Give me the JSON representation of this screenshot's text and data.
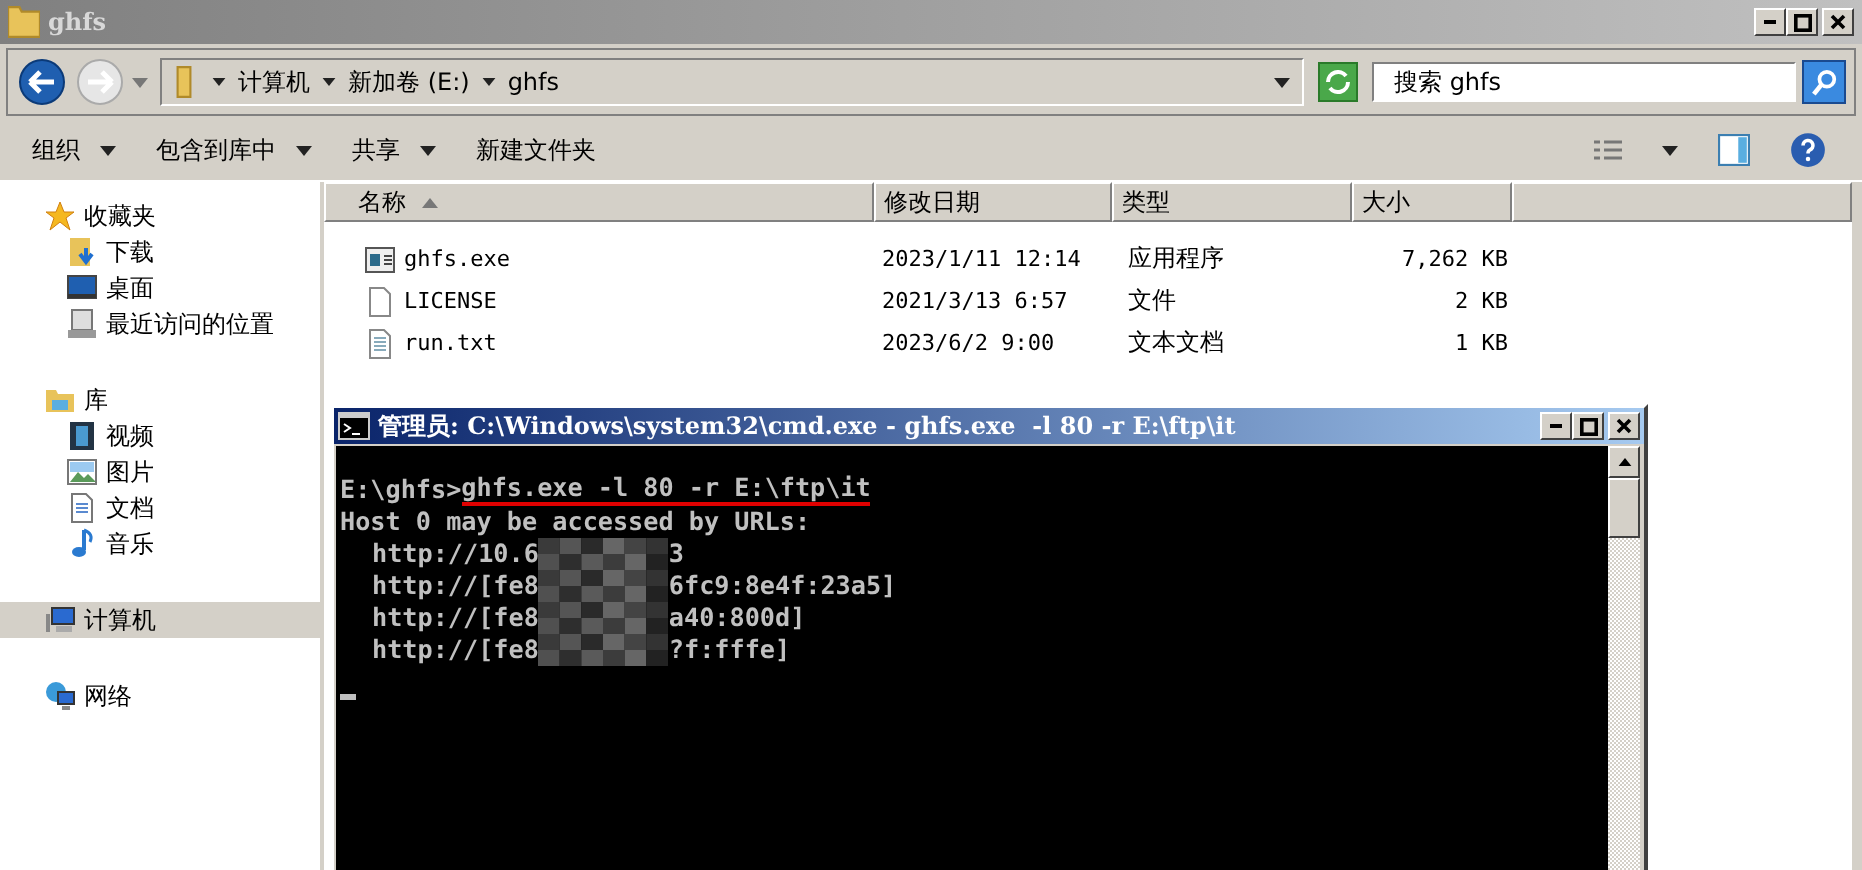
{
  "window": {
    "title": "ghfs"
  },
  "address_bar": {
    "crumbs": [
      "计算机",
      "新加卷 (E:)",
      "ghfs"
    ]
  },
  "search": {
    "placeholder": "搜索 ghfs"
  },
  "toolbar": [
    {
      "label": "组织",
      "dropdown": true
    },
    {
      "label": "包含到库中",
      "dropdown": true
    },
    {
      "label": "共享",
      "dropdown": true
    },
    {
      "label": "新建文件夹",
      "dropdown": false
    }
  ],
  "sidebar": {
    "groups": [
      {
        "label": "收藏夹",
        "selected": false,
        "children": [
          {
            "label": "下载",
            "selected": false
          },
          {
            "label": "桌面",
            "selected": false
          },
          {
            "label": "最近访问的位置",
            "selected": false
          }
        ]
      },
      {
        "label": "库",
        "selected": false,
        "children": [
          {
            "label": "视频",
            "selected": false
          },
          {
            "label": "图片",
            "selected": false
          },
          {
            "label": "文档",
            "selected": false
          },
          {
            "label": "音乐",
            "selected": false
          }
        ]
      },
      {
        "label": "计算机",
        "selected": true
      },
      {
        "label": "网络",
        "selected": false
      }
    ]
  },
  "table": {
    "columns": [
      "名称",
      "修改日期",
      "类型",
      "大小"
    ],
    "rows": [
      {
        "name": "ghfs.exe",
        "date": "2023/1/11 12:14",
        "type": "应用程序",
        "size": "7,262 KB"
      },
      {
        "name": "LICENSE",
        "date": "2021/3/13 6:57",
        "type": "文件",
        "size": "2 KB"
      },
      {
        "name": "run.txt",
        "date": "2023/6/2 9:00",
        "type": "文本文档",
        "size": "1 KB"
      }
    ]
  },
  "console": {
    "title": "管理员: C:\\Windows\\system32\\cmd.exe - ghfs.exe  -l 80 -r E:\\ftp\\it",
    "prompt": "E:\\ghfs>",
    "command": "ghfs.exe -l 80 -r E:\\ftp\\it",
    "output": "Host 0 may be accessed by URLs:",
    "urls": [
      {
        "start": "http://10.6",
        "end": "3"
      },
      {
        "start": "http://[fe8",
        "end": "6fc9:8e4f:23a5]"
      },
      {
        "start": "http://[fe8",
        "end": "a40:800d]"
      },
      {
        "start": "http://[fe8",
        "end": "?f:fffe]"
      }
    ]
  }
}
